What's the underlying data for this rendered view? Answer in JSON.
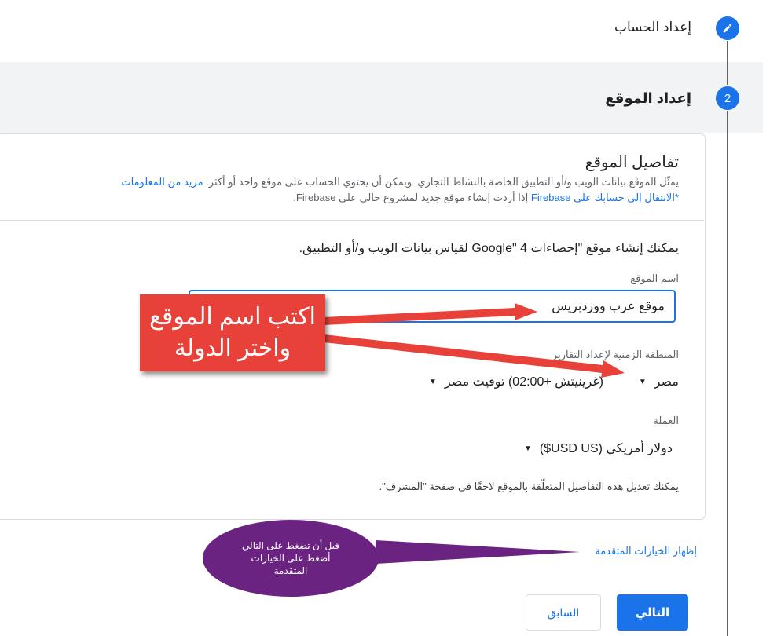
{
  "stepper": {
    "step1": {
      "label": "إعداد الحساب",
      "icon": "pencil-icon"
    },
    "step2": {
      "number": "2",
      "label": "إعداد الموقع"
    }
  },
  "card": {
    "title": "تفاصيل الموقع",
    "desc_line1": "يمثّل الموقع بيانات الويب و/أو التطبيق الخاصة بالنشاط التجاري. ويمكن أن يحتوي الحساب على موقع واحد أو أكثر.",
    "desc_link1": "مزيد من المعلومات",
    "desc_line2_link": "*الانتقال إلى حسابك على Firebase",
    "desc_line2_rest": "إذا أردتَ إنشاء موقع جديد لمشروع حالي على Firebase."
  },
  "form": {
    "intro": "يمكنك إنشاء موقع \"إحصاءات Google\" 4 لقياس بيانات الويب و/أو التطبيق.",
    "property_name_label": "اسم الموقع",
    "property_name_value": "موقع عرب ووردبريس",
    "timezone_label": "المنطقة الزمنية لإعداد التقارير",
    "timezone_country": "مصر",
    "timezone_value": "(غرينيتش +02:00) توقيت مصر",
    "currency_label": "العملة",
    "currency_value": "دولار أمريكي (USD US$)",
    "note": "يمكنك تعديل هذه التفاصيل المتعلّقة بالموقع لاحقًا في صفحة \"المشرف\"."
  },
  "advanced_link": "إظهار الخيارات المتقدمة",
  "buttons": {
    "prev": "السابق",
    "next": "التالي"
  },
  "annotations": {
    "red_line1": "اكتب اسم الموقع",
    "red_line2": "واختر الدولة",
    "purple_line1": "قبل أن تضغط على التالي",
    "purple_line2": "أضغط على الخيارات",
    "purple_line3": "المتقدمة"
  },
  "colors": {
    "accent": "#1a73e8",
    "annotation_red": "#e8413a",
    "annotation_purple": "#6b2382"
  }
}
